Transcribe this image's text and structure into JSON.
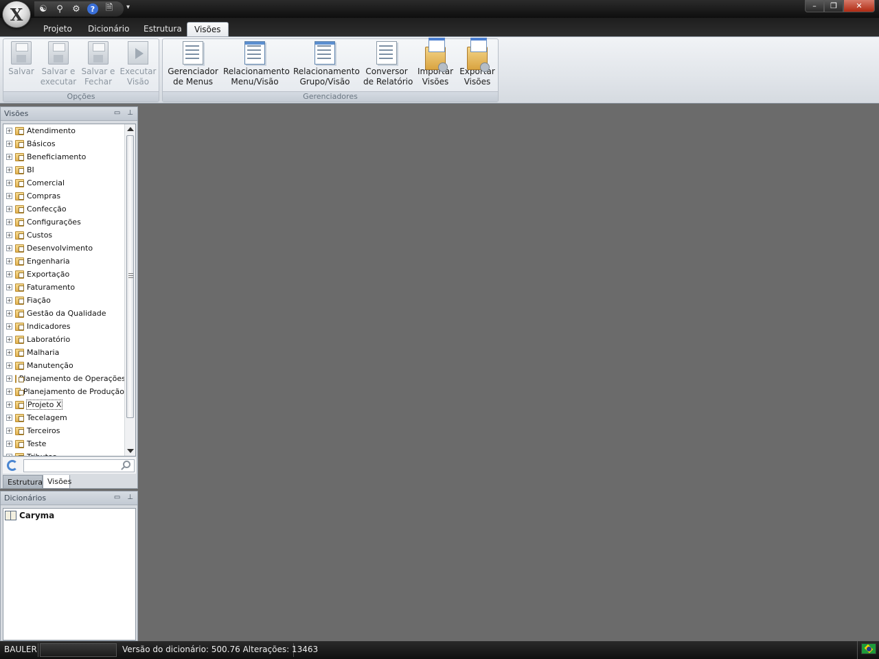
{
  "app": {
    "orb_glyph": "X"
  },
  "quick_access": {
    "icons": [
      "users-icon",
      "search-icon",
      "gear-icon",
      "help-icon",
      "document-info-icon"
    ],
    "help_glyph": "?",
    "dropdown_glyph": "▾"
  },
  "window_controls": {
    "minimize": "–",
    "restore": "❐",
    "close": "✕"
  },
  "tabs": [
    {
      "label": "Projeto"
    },
    {
      "label": "Dicionário"
    },
    {
      "label": "Estrutura"
    },
    {
      "label": "Visões",
      "active": true
    }
  ],
  "ribbon": {
    "groups": [
      {
        "label": "Opções",
        "buttons": [
          {
            "line1": "Salvar",
            "line2": "",
            "icon": "save-icon",
            "disabled": true
          },
          {
            "line1": "Salvar e",
            "line2": "executar",
            "icon": "save-execute-icon",
            "disabled": true
          },
          {
            "line1": "Salvar e",
            "line2": "Fechar",
            "icon": "save-close-icon",
            "disabled": true
          },
          {
            "line1": "Executar",
            "line2": "Visão",
            "icon": "execute-icon",
            "disabled": true
          }
        ]
      },
      {
        "label": "Gerenciadores",
        "buttons": [
          {
            "line1": "Gerenciador",
            "line2": "de Menus",
            "icon": "menu-manager-icon"
          },
          {
            "line1": "Relacionamento",
            "line2": "Menu/Visão",
            "icon": "menu-relation-icon"
          },
          {
            "line1": "Relacionamento",
            "line2": "Grupo/Visão",
            "icon": "group-relation-icon"
          },
          {
            "line1": "Conversor",
            "line2": "de Relatório",
            "icon": "report-converter-icon"
          },
          {
            "line1": "Importar",
            "line2": "Visões",
            "icon": "import-icon"
          },
          {
            "line1": "Exportar",
            "line2": "Visões",
            "icon": "export-icon"
          }
        ]
      }
    ]
  },
  "visoes_panel": {
    "title": "Visões",
    "items": [
      "Atendimento",
      "Básicos",
      "Beneficiamento",
      "BI",
      "Comercial",
      "Compras",
      "Confecção",
      "Configurações",
      "Custos",
      "Desenvolvimento",
      "Engenharia",
      "Exportação",
      "Faturamento",
      "Fiação",
      "Gestão da Qualidade",
      "Indicadores",
      "Laboratório",
      "Malharia",
      "Manutenção",
      "Planejamento de Operações",
      "Planejamento de Produção",
      "Projeto X",
      "Tecelagem",
      "Terceiros",
      "Teste",
      "Tributos"
    ],
    "selected": "Projeto X",
    "search": {
      "value": "",
      "placeholder": ""
    },
    "bottom_tabs": [
      "Estrutura",
      "Visões"
    ],
    "active_bottom_tab": "Visões"
  },
  "dicionarios_panel": {
    "title": "Dicionários",
    "items": [
      "Caryma"
    ]
  },
  "statusbar": {
    "user": "BAULER",
    "version_text": "Versão do dicionário: 500.76 Alterações: 13463"
  },
  "colors": {
    "workspace": "#6b6b6b",
    "ribbon": "#e1e5ea",
    "chrome_dark": "#1a1a1a"
  }
}
